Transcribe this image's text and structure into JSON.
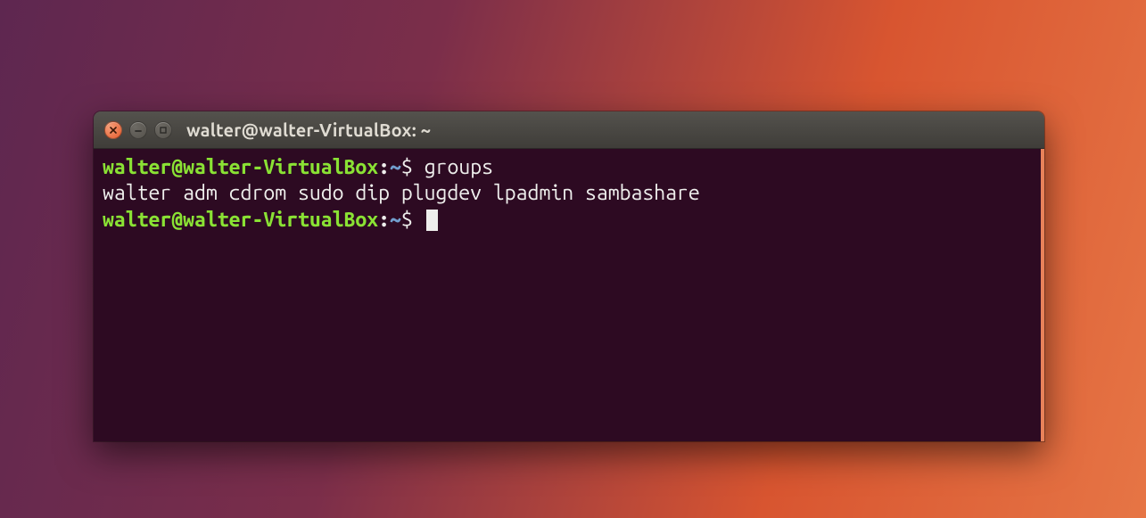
{
  "window": {
    "title": "walter@walter-VirtualBox: ~"
  },
  "prompt": {
    "user_host": "walter@walter-VirtualBox",
    "separator": ":",
    "path": "~",
    "symbol": "$"
  },
  "session": {
    "line1_command": "groups",
    "line2_output": "walter adm cdrom sudo dip plugdev lpadmin sambashare"
  }
}
